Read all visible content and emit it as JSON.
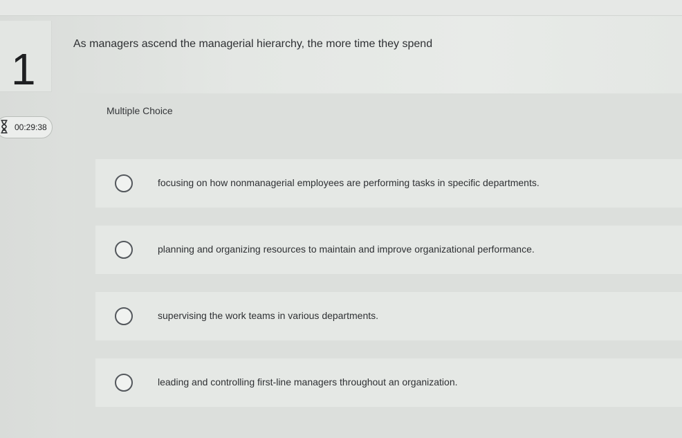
{
  "question": {
    "number": "1",
    "text": "As managers ascend the managerial hierarchy, the more time they spend"
  },
  "timer": {
    "icon": "hourglass-icon",
    "value": "00:29:38"
  },
  "panel": {
    "title": "Multiple Choice"
  },
  "choices": [
    {
      "label": "focusing on how nonmanagerial employees are performing tasks in specific departments."
    },
    {
      "label": "planning and organizing resources to maintain and improve organizational performance."
    },
    {
      "label": "supervising the work teams in various departments."
    },
    {
      "label": "leading and controlling first-line managers throughout an organization."
    }
  ]
}
